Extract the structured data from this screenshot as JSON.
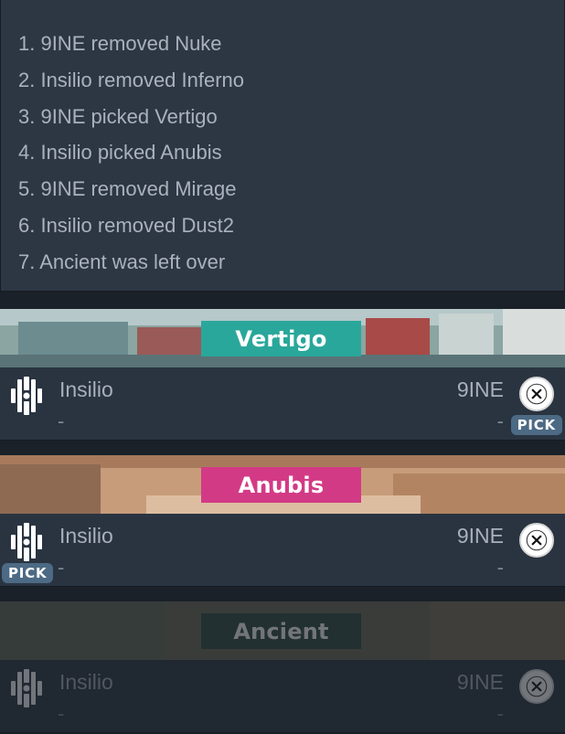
{
  "veto": {
    "steps": [
      "1. 9INE removed Nuke",
      "2. Insilio removed Inferno",
      "3. 9INE picked Vertigo",
      "4. Insilio picked Anubis",
      "5. 9INE removed Mirage",
      "6. Insilio removed Dust2",
      "7. Ancient was left over"
    ]
  },
  "maps": [
    {
      "name": "Vertigo",
      "band_color": "#2aa79b",
      "team_left": {
        "name": "Insilio",
        "score": "-"
      },
      "team_right": {
        "name": "9INE",
        "score": "-"
      },
      "pick_label": "PICK",
      "picked_by": "right"
    },
    {
      "name": "Anubis",
      "band_color": "#d33a86",
      "team_left": {
        "name": "Insilio",
        "score": "-"
      },
      "team_right": {
        "name": "9INE",
        "score": "-"
      },
      "pick_label": "PICK",
      "picked_by": "left"
    },
    {
      "name": "Ancient",
      "band_color": "#2e4a3f",
      "team_left": {
        "name": "Insilio",
        "score": "-"
      },
      "team_right": {
        "name": "9INE",
        "score": "-"
      },
      "picked_by": "none",
      "state": "decider"
    }
  ],
  "icons": {
    "team_left_logo": "insilio-logo-icon",
    "team_right_logo": "9ine-logo-icon"
  }
}
